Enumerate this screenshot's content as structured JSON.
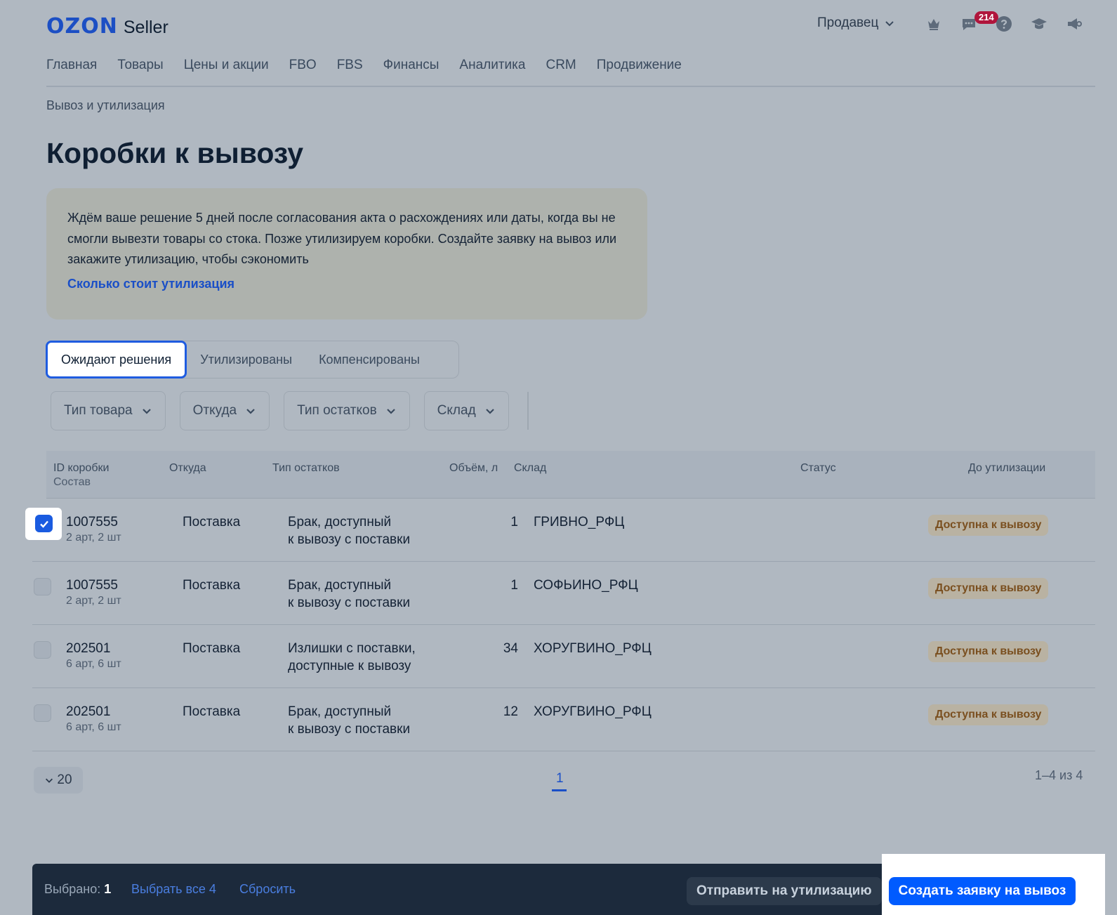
{
  "header": {
    "logo_ozon": "OZON",
    "logo_seller": "Seller",
    "seller_menu": "Продавец",
    "notifications_count": "214"
  },
  "nav": {
    "items": [
      "Главная",
      "Товары",
      "Цены и акции",
      "FBO",
      "FBS",
      "Финансы",
      "Аналитика",
      "CRM",
      "Продвижение"
    ]
  },
  "breadcrumb": "Вывоз и утилизация",
  "page_title": "Коробки к вывозу",
  "info": {
    "text": "Ждём ваше решение 5 дней после согласования акта о расхождениях или даты, когда вы не смогли вывезти товары со стока. Позже утилизируем коробки. Создайте заявку на вывоз или закажите утилизацию, чтобы сэкономить",
    "link": "Сколько стоит утилизация"
  },
  "tabs": [
    "Ожидают решения",
    "Утилизированы",
    "Компенсированы"
  ],
  "filters": [
    "Тип товара",
    "Откуда",
    "Тип остатков",
    "Склад"
  ],
  "table": {
    "headers": {
      "id": "ID коробки",
      "id_sub": "Состав",
      "from": "Откуда",
      "stock_type": "Тип остатков",
      "volume": "Объём, л",
      "warehouse": "Склад",
      "status": "Статус",
      "until": "До утилизации"
    },
    "rows": [
      {
        "id": "1007555",
        "composition": "2 арт, 2 шт",
        "from": "Поставка",
        "type1": "Брак, доступный",
        "type2": "к вывозу с поставки",
        "volume": "1",
        "warehouse": "ГРИВНО_РФЦ",
        "status": "Доступна к вывозу",
        "checked": true
      },
      {
        "id": "1007555",
        "composition": "2 арт, 2 шт",
        "from": "Поставка",
        "type1": "Брак, доступный",
        "type2": "к вывозу с поставки",
        "volume": "1",
        "warehouse": "СОФЬИНО_РФЦ",
        "status": "Доступна к вывозу",
        "checked": false
      },
      {
        "id": "202501",
        "composition": "6 арт, 6 шт",
        "from": "Поставка",
        "type1": "Излишки с поставки,",
        "type2": "доступные к вывозу",
        "volume": "34",
        "warehouse": "ХОРУГВИНО_РФЦ",
        "status": "Доступна к вывозу",
        "checked": false
      },
      {
        "id": "202501",
        "composition": "6 арт, 6 шт",
        "from": "Поставка",
        "type1": "Брак, доступный",
        "type2": "к вывозу с поставки",
        "volume": "12",
        "warehouse": "ХОРУГВИНО_РФЦ",
        "status": "Доступна к вывозу",
        "checked": false
      }
    ]
  },
  "pager": {
    "page_size": "20",
    "current_page": "1",
    "range": "1–4 из 4"
  },
  "bottom_bar": {
    "selected_label": "Выбрано:",
    "selected_count": "1",
    "select_all": "Выбрать все 4",
    "reset": "Сбросить",
    "send_util": "Отправить на утилизацию",
    "create_request": "Создать заявку на вывоз"
  },
  "colors": {
    "accent": "#005bff",
    "link": "#1a4fc7",
    "badge": "#b0153c",
    "status_text": "#7a4f1f"
  }
}
